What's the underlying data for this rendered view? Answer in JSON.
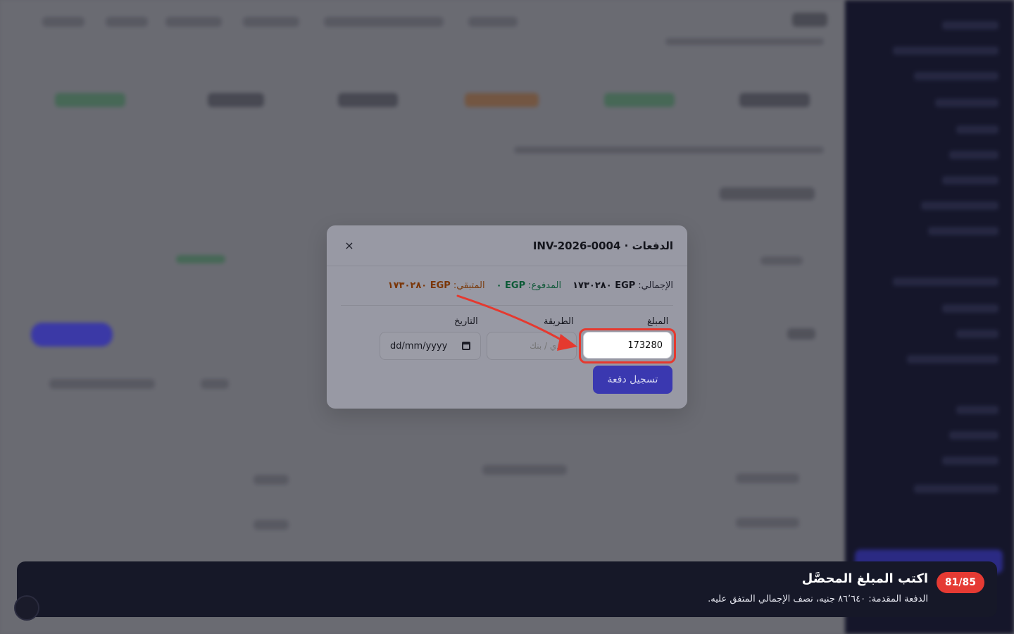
{
  "modal": {
    "title": "الدفعات · INV-2026-0004",
    "close_label": "×",
    "summary": {
      "total_label": "الإجمالي:",
      "total_value": "EGP ١٧٣٠٢٨٠",
      "paid_label": "المدفوع:",
      "paid_value": "EGP ٠",
      "remaining_label": "المتبقي:",
      "remaining_value": "EGP ١٧٣٠٢٨٠"
    },
    "fields": {
      "amount_label": "المبلغ",
      "amount_value": "173280",
      "method_label": "الطريقة",
      "method_placeholder": "نقدي / بنك",
      "date_label": "التاريخ",
      "date_placeholder": "dd/mm/yyyy"
    },
    "submit_label": "تسجيل دفعة"
  },
  "banner": {
    "step": "81/85",
    "title": "اكتب المبلغ المحصَّل",
    "description": "الدفعة المقدمة: ٨٦٬٦٤٠ جنيه، نصف الإجمالي المتفق عليه."
  },
  "icons": {
    "close": "close-icon",
    "calendar": "calendar-icon",
    "arrow": "pointer-arrow-icon"
  },
  "colors": {
    "accent": "#3a38b0",
    "highlight": "#e5392f",
    "paid": "#0c5a36",
    "remaining": "#7a3506",
    "banner_bg": "#161828"
  }
}
